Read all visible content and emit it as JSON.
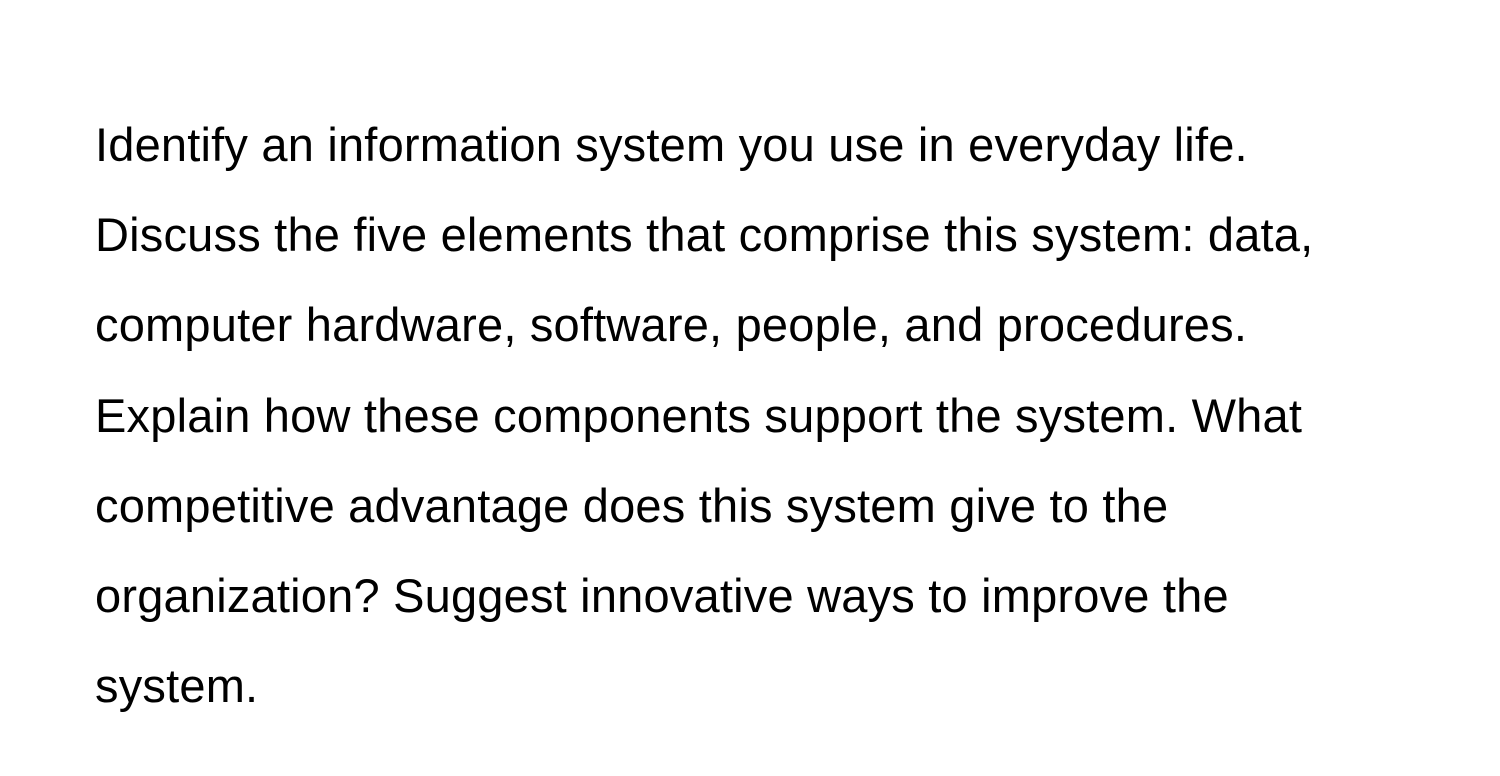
{
  "document": {
    "paragraph": "Identify an information system you use in everyday life. Discuss the five elements that comprise this system: data, computer hardware, software, people, and procedures. Explain how these components support the system. What competitive advantage does this system give to the organization? Suggest innovative ways to improve the system."
  }
}
